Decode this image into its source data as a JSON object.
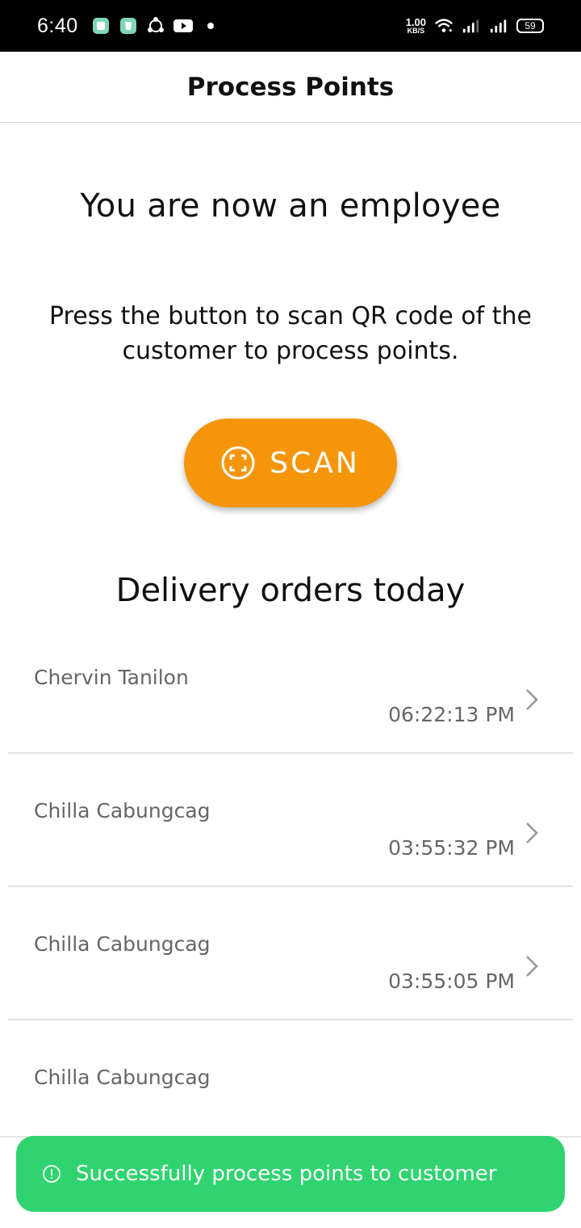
{
  "status_bar": {
    "time": "6:40",
    "network_speed_value": "1.00",
    "network_speed_unit": "KB/S",
    "battery": "59",
    "icons": [
      "app-icon",
      "app-icon-2",
      "share-icon",
      "youtube-icon",
      "dot-icon",
      "wifi-icon",
      "signal-icon",
      "signal-icon-2",
      "battery-icon"
    ]
  },
  "header": {
    "title": "Process Points"
  },
  "main": {
    "headline": "You are now an employee",
    "instruction": "Press the button to scan QR code of the customer to process points.",
    "scan_button_label": "SCAN",
    "section_title": "Delivery orders today"
  },
  "orders": [
    {
      "name": "Chervin Tanilon",
      "time": "06:22:13 PM"
    },
    {
      "name": "Chilla Cabungcag",
      "time": "03:55:32 PM"
    },
    {
      "name": "Chilla Cabungcag",
      "time": "03:55:05 PM"
    },
    {
      "name": "Chilla Cabungcag",
      "time": ""
    }
  ],
  "toast": {
    "message": "Successfully process points to customer"
  },
  "colors": {
    "accent": "#f5960a",
    "success": "#2fd470"
  }
}
